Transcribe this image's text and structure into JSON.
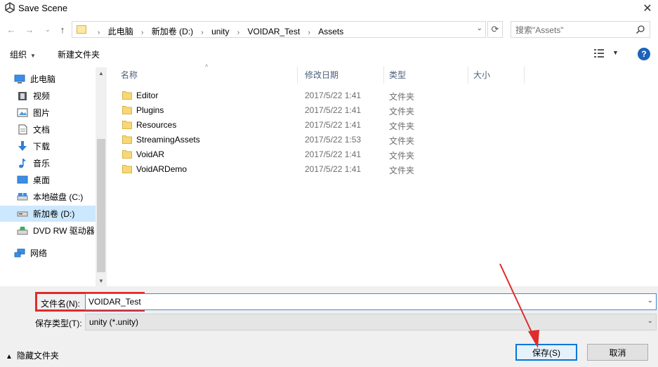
{
  "window": {
    "title": "Save Scene",
    "close_glyph": "✕"
  },
  "nav": {
    "back_glyph": "←",
    "forward_glyph": "→",
    "recent_glyph": "⌄",
    "up_glyph": "↑",
    "breadcrumbs": [
      "此电脑",
      "新加卷 (D:)",
      "unity",
      "VOIDAR_Test",
      "Assets"
    ],
    "refresh_glyph": "⟳",
    "search_placeholder": "搜索\"Assets\""
  },
  "toolbar": {
    "organize_label": "组织",
    "new_folder_label": "新建文件夹",
    "help_glyph": "?"
  },
  "sidebar": {
    "items": [
      {
        "label": "此电脑",
        "icon": "computer-icon"
      },
      {
        "label": "视频",
        "icon": "video-icon"
      },
      {
        "label": "图片",
        "icon": "pictures-icon"
      },
      {
        "label": "文档",
        "icon": "documents-icon"
      },
      {
        "label": "下载",
        "icon": "download-icon"
      },
      {
        "label": "音乐",
        "icon": "music-icon"
      },
      {
        "label": "桌面",
        "icon": "desktop-icon"
      },
      {
        "label": "本地磁盘 (C:)",
        "icon": "drive-icon"
      },
      {
        "label": "新加卷 (D:)",
        "icon": "drive-icon",
        "selected": true
      },
      {
        "label": "DVD RW 驱动器",
        "icon": "dvd-icon"
      },
      {
        "label": "网络",
        "icon": "network-icon"
      }
    ]
  },
  "columns": {
    "name": "名称",
    "date": "修改日期",
    "type": "类型",
    "size": "大小"
  },
  "files": [
    {
      "name": "Editor",
      "date": "2017/5/22 1:41",
      "type": "文件夹"
    },
    {
      "name": "Plugins",
      "date": "2017/5/22 1:41",
      "type": "文件夹"
    },
    {
      "name": "Resources",
      "date": "2017/5/22 1:41",
      "type": "文件夹"
    },
    {
      "name": "StreamingAssets",
      "date": "2017/5/22 1:53",
      "type": "文件夹"
    },
    {
      "name": "VoidAR",
      "date": "2017/5/22 1:41",
      "type": "文件夹"
    },
    {
      "name": "VoidARDemo",
      "date": "2017/5/22 1:41",
      "type": "文件夹"
    }
  ],
  "form": {
    "filename_label": "文件名(N):",
    "filename_value": "VOIDAR_Test",
    "type_label": "保存类型(T):",
    "type_value": "unity (*.unity)",
    "hide_folders_label": "隐藏文件夹",
    "save_label": "保存(S)",
    "cancel_label": "取消"
  },
  "colors": {
    "accent": "#0078d7",
    "highlight": "#e02b2b",
    "folder": "#f8d775",
    "selected": "#cce8ff"
  }
}
